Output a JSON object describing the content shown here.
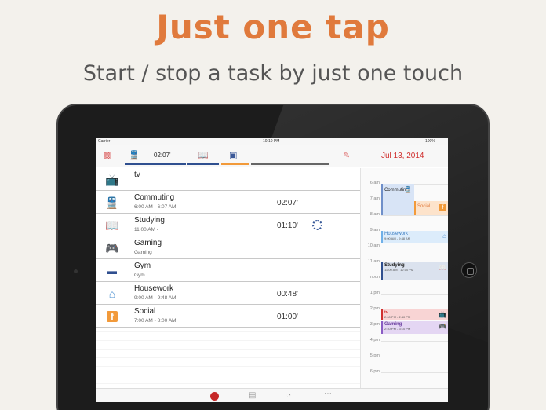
{
  "headline": "Just one tap",
  "subline": "Start / stop a task by just one touch",
  "status": {
    "carrier": "Carrier",
    "time": "10:10 PM",
    "battery": "100%"
  },
  "toolbar": {
    "inbox_icon": "inbox-icon",
    "active": [
      {
        "icon": "train-icon",
        "time": "02:07'",
        "color": "#2f4f8f"
      },
      {
        "icon": "book-icon",
        "time": "",
        "color": "#2f4f8f"
      },
      {
        "icon": "facebook-icon",
        "time": "",
        "color": "#f29a3a"
      }
    ],
    "edit_icon": "edit-icon",
    "date": "Jul 13, 2014"
  },
  "tasks": [
    {
      "title": "tv",
      "sub": "",
      "duration": "",
      "icon": "tv-icon",
      "color": "#d0302f"
    },
    {
      "title": "Commuting",
      "sub": "6:00 AM - 6:07 AM",
      "duration": "02:07'",
      "icon": "train-icon",
      "color": "#2f4f8f"
    },
    {
      "title": "Studying",
      "sub": "11:00 AM -",
      "duration": "01:10'",
      "icon": "book-icon",
      "color": "#333333"
    },
    {
      "title": "Gaming",
      "sub": "Gaming",
      "duration": "",
      "icon": "gamepad-icon",
      "color": "#6b3fa0"
    },
    {
      "title": "Gym",
      "sub": "Gym",
      "duration": "",
      "icon": "dumbbell-icon",
      "color": "#2f4f8f"
    },
    {
      "title": "Housework",
      "sub": "9:00 AM - 9:48 AM",
      "duration": "00:48'",
      "icon": "house-icon",
      "color": "#4a8fd0"
    },
    {
      "title": "Social",
      "sub": "7:00 AM - 8:00 AM",
      "duration": "01:00'",
      "icon": "facebook-icon",
      "color": "#f29a3a"
    }
  ],
  "timeline": {
    "hours": [
      "6 am",
      "7 am",
      "8 am",
      "9 am",
      "10 am",
      "11 am",
      "noon",
      "1 pm",
      "2 pm",
      "3 pm",
      "4 pm",
      "5 pm",
      "6 pm"
    ],
    "events": [
      {
        "title": "Commuting",
        "sub": "",
        "icon": "train-icon",
        "bg": "#d8e4f6",
        "border": "#6f8fc9"
      },
      {
        "title": "Social",
        "sub": "",
        "icon": "facebook-icon",
        "bg": "#fde3cb",
        "border": "#f29a3a"
      },
      {
        "title": "Housework",
        "sub": "9:00 AM - 9:48 AM",
        "icon": "house-icon",
        "bg": "#dcecfb",
        "border": "#6fb0e8"
      },
      {
        "title": "Studying",
        "sub": "11:00 AM - 12:10 PM",
        "icon": "book-icon",
        "bg": "#dbe2ee",
        "border": "#2f4f8f"
      },
      {
        "title": "tv",
        "sub": "2:00 PM - 2:40 PM",
        "icon": "tv-icon",
        "bg": "#f8d4d4",
        "border": "#d0302f"
      },
      {
        "title": "Gaming",
        "sub": "2:40 PM - 3:10 PM",
        "icon": "gamepad-icon",
        "bg": "#e4d6f3",
        "border": "#8a5cc4"
      }
    ]
  },
  "bottom": {
    "icons": [
      "clock-icon",
      "document-icon",
      "pie-chart-icon",
      "more-icon"
    ]
  }
}
